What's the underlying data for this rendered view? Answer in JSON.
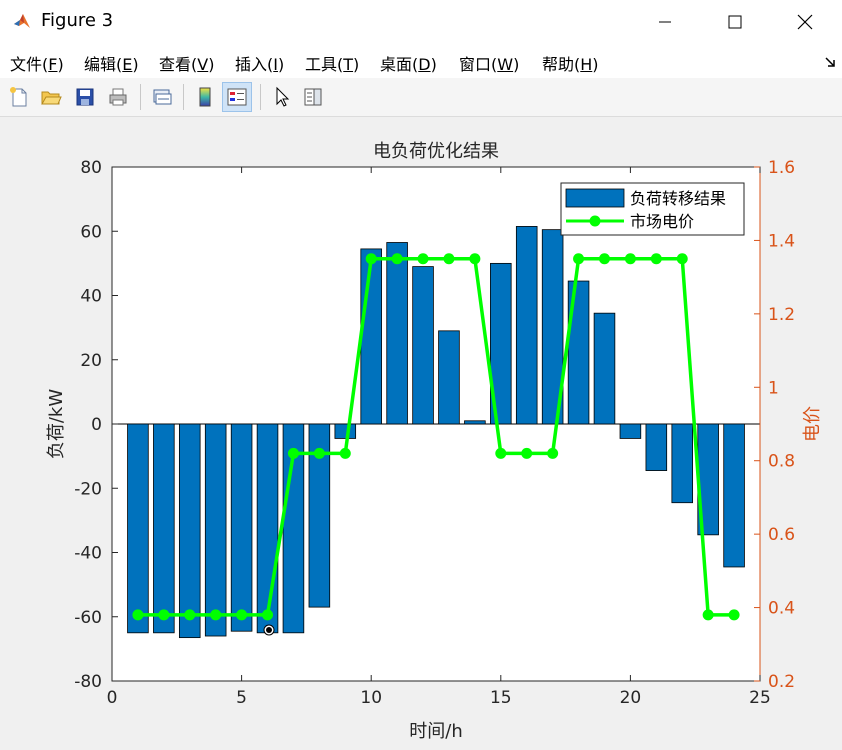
{
  "window": {
    "title": "Figure 3",
    "minimize_label": "—",
    "maximize_label": "☐",
    "close_label": "✕"
  },
  "menu": [
    {
      "label": "文件",
      "key": "F"
    },
    {
      "label": "编辑",
      "key": "E"
    },
    {
      "label": "查看",
      "key": "V"
    },
    {
      "label": "插入",
      "key": "I"
    },
    {
      "label": "工具",
      "key": "T"
    },
    {
      "label": "桌面",
      "key": "D"
    },
    {
      "label": "窗口",
      "key": "W"
    },
    {
      "label": "帮助",
      "key": "H"
    }
  ],
  "toolbar": [
    {
      "icon": "new-figure-icon"
    },
    {
      "icon": "open-file-icon"
    },
    {
      "icon": "save-icon"
    },
    {
      "icon": "print-icon"
    },
    {
      "icon": "link-plot-icon"
    },
    {
      "icon": "colorbar-icon"
    },
    {
      "icon": "legend-icon",
      "active": true
    },
    {
      "icon": "pointer-icon"
    },
    {
      "icon": "property-inspector-icon"
    }
  ],
  "colors": {
    "bar_fill": "#0072bd",
    "line": "#00ff00",
    "right_axis": "#d95319",
    "axis": "#262626"
  },
  "chart_data": {
    "type": "bar",
    "title": "电负荷优化结果",
    "xlabel": "时间/h",
    "ylabel_left": "负荷/kW",
    "ylabel_right": "电价",
    "xlim": [
      0,
      25
    ],
    "ylim_left": [
      -80,
      80
    ],
    "ylim_right": [
      0.2,
      1.6
    ],
    "x_ticks": [
      0,
      5,
      10,
      15,
      20,
      25
    ],
    "y_ticks_left": [
      -80,
      -60,
      -40,
      -20,
      0,
      20,
      40,
      60,
      80
    ],
    "y_ticks_right": [
      "0.2",
      "0.4",
      "0.6",
      "0.8",
      "1",
      "1.2",
      "1.4",
      "1.6"
    ],
    "legend_position": "top-right",
    "series": [
      {
        "name": "负荷转移结果",
        "type": "bar",
        "axis": "left",
        "x": [
          1,
          2,
          3,
          4,
          5,
          6,
          7,
          8,
          9,
          10,
          11,
          12,
          13,
          14,
          15,
          16,
          17,
          18,
          19,
          20,
          21,
          22,
          23,
          24
        ],
        "values": [
          -65,
          -65,
          -66.5,
          -66,
          -64.5,
          -65,
          -65,
          -57,
          -4.5,
          54.5,
          56.5,
          49,
          29,
          1,
          50,
          61.5,
          60.5,
          44.5,
          34.5,
          -4.5,
          -14.5,
          -24.5,
          -34.5,
          -44.5
        ]
      },
      {
        "name": "市场电价",
        "type": "line",
        "axis": "right",
        "x": [
          1,
          2,
          3,
          4,
          5,
          6,
          7,
          8,
          9,
          10,
          11,
          12,
          13,
          14,
          15,
          16,
          17,
          18,
          19,
          20,
          21,
          22,
          23,
          24
        ],
        "values": [
          0.38,
          0.38,
          0.38,
          0.38,
          0.38,
          0.38,
          0.82,
          0.82,
          0.82,
          1.35,
          1.35,
          1.35,
          1.35,
          1.35,
          0.82,
          0.82,
          0.82,
          1.35,
          1.35,
          1.35,
          1.35,
          1.35,
          0.38,
          0.38
        ]
      }
    ]
  }
}
